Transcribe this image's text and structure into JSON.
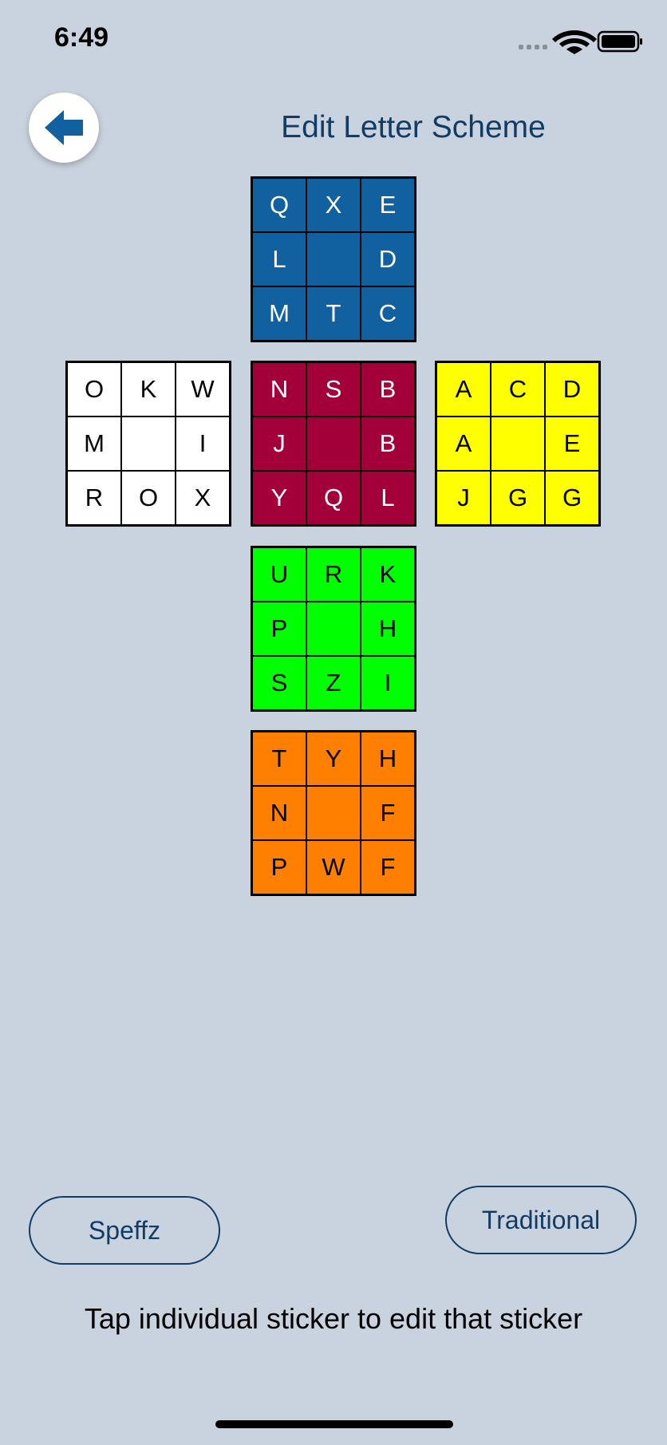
{
  "status_bar": {
    "time": "6:49"
  },
  "header": {
    "title": "Edit Letter Scheme"
  },
  "faces": {
    "up": {
      "color": "#1160a0",
      "text_color": "#ffffff",
      "stickers": [
        "Q",
        "X",
        "E",
        "L",
        "",
        "D",
        "M",
        "T",
        "C"
      ]
    },
    "left": {
      "color": "#ffffff",
      "text_color": "#000000",
      "stickers": [
        "O",
        "K",
        "W",
        "M",
        "",
        "I",
        "R",
        "O",
        "X"
      ]
    },
    "front": {
      "color": "#a3003a",
      "text_color": "#ffffff",
      "stickers": [
        "N",
        "S",
        "B",
        "J",
        "",
        "B",
        "Y",
        "Q",
        "L"
      ]
    },
    "right": {
      "color": "#ffff00",
      "text_color": "#000000",
      "stickers": [
        "A",
        "C",
        "D",
        "A",
        "",
        "E",
        "J",
        "G",
        "G"
      ]
    },
    "down": {
      "color": "#00ff00",
      "text_color": "#000000",
      "stickers": [
        "U",
        "R",
        "K",
        "P",
        "",
        "H",
        "S",
        "Z",
        "I"
      ]
    },
    "back": {
      "color": "#ff7f00",
      "text_color": "#000000",
      "stickers": [
        "T",
        "Y",
        "H",
        "N",
        "",
        "F",
        "P",
        "W",
        "F"
      ]
    }
  },
  "buttons": {
    "speffz": "Speffz",
    "traditional": "Traditional"
  },
  "hint": "Tap individual sticker to edit that sticker"
}
